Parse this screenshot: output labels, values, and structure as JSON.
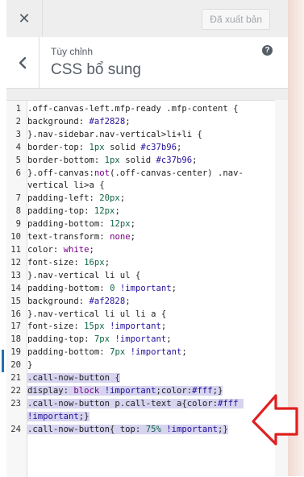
{
  "header": {
    "close_glyph": "✕",
    "publish_label": "Đã xuất bản"
  },
  "section": {
    "breadcrumb": "Tùy chỉnh",
    "title": "CSS bổ sung",
    "help_glyph": "?"
  },
  "editor": {
    "lines": [
      {
        "n": "1",
        "tokens": [
          [
            ".off-canvas-left.mfp-ready .mfp-content {",
            "plain"
          ]
        ]
      },
      {
        "n": "2",
        "tokens": [
          [
            "background: ",
            "plain"
          ],
          [
            "#af2828",
            "str"
          ],
          [
            ";",
            "plain"
          ]
        ]
      },
      {
        "n": "3",
        "tokens": [
          [
            "}.nav-sidebar.nav-vertical>li+li {",
            "plain"
          ]
        ]
      },
      {
        "n": "4",
        "tokens": [
          [
            "border-top: ",
            "plain"
          ],
          [
            "1px",
            "num"
          ],
          [
            " solid ",
            "plain"
          ],
          [
            "#c37b96",
            "str"
          ],
          [
            ";",
            "plain"
          ]
        ]
      },
      {
        "n": "5",
        "tokens": [
          [
            "border-bottom: ",
            "plain"
          ],
          [
            "1px",
            "num"
          ],
          [
            " solid ",
            "plain"
          ],
          [
            "#c37b96",
            "str"
          ],
          [
            ";",
            "plain"
          ]
        ]
      },
      {
        "n": "6",
        "tokens": [
          [
            "}.off-canvas:",
            "plain"
          ],
          [
            "not",
            "kw"
          ],
          [
            "(.off-canvas-center) .nav-vertical li>a {",
            "plain"
          ]
        ]
      },
      {
        "n": "7",
        "tokens": [
          [
            "padding-left: ",
            "plain"
          ],
          [
            "20px",
            "num"
          ],
          [
            ";",
            "plain"
          ]
        ]
      },
      {
        "n": "8",
        "tokens": [
          [
            "padding-top: ",
            "plain"
          ],
          [
            "12px",
            "num"
          ],
          [
            ";",
            "plain"
          ]
        ]
      },
      {
        "n": "9",
        "tokens": [
          [
            "padding-bottom: ",
            "plain"
          ],
          [
            "12px",
            "num"
          ],
          [
            ";",
            "plain"
          ]
        ]
      },
      {
        "n": "10",
        "tokens": [
          [
            "text-transform: ",
            "plain"
          ],
          [
            "none",
            "kw"
          ],
          [
            ";",
            "plain"
          ]
        ]
      },
      {
        "n": "11",
        "tokens": [
          [
            "color: ",
            "plain"
          ],
          [
            "white",
            "kw"
          ],
          [
            ";",
            "plain"
          ]
        ]
      },
      {
        "n": "12",
        "tokens": [
          [
            "font-size: ",
            "plain"
          ],
          [
            "16px",
            "num"
          ],
          [
            ";",
            "plain"
          ]
        ]
      },
      {
        "n": "13",
        "tokens": [
          [
            "}.nav-vertical li ul {",
            "plain"
          ]
        ]
      },
      {
        "n": "14",
        "tokens": [
          [
            "padding-bottom: ",
            "plain"
          ],
          [
            "0",
            "num"
          ],
          [
            " ",
            "plain"
          ],
          [
            "!important",
            "imp"
          ],
          [
            ";",
            "plain"
          ]
        ]
      },
      {
        "n": "15",
        "tokens": [
          [
            "background: ",
            "plain"
          ],
          [
            "#af2828",
            "str"
          ],
          [
            ";",
            "plain"
          ]
        ]
      },
      {
        "n": "16",
        "tokens": [
          [
            "}.nav-vertical li ul li a {",
            "plain"
          ]
        ]
      },
      {
        "n": "17",
        "tokens": [
          [
            "font-size: ",
            "plain"
          ],
          [
            "15px",
            "num"
          ],
          [
            " ",
            "plain"
          ],
          [
            "!important",
            "imp"
          ],
          [
            ";",
            "plain"
          ]
        ]
      },
      {
        "n": "18",
        "tokens": [
          [
            "padding-top: ",
            "plain"
          ],
          [
            "7px",
            "num"
          ],
          [
            " ",
            "plain"
          ],
          [
            "!important",
            "imp"
          ],
          [
            ";",
            "plain"
          ]
        ]
      },
      {
        "n": "19",
        "tokens": [
          [
            "padding-bottom: ",
            "plain"
          ],
          [
            "7px",
            "num"
          ],
          [
            " ",
            "plain"
          ],
          [
            "!important",
            "imp"
          ],
          [
            ";",
            "plain"
          ]
        ]
      },
      {
        "n": "20",
        "tokens": [
          [
            "}",
            "plain"
          ]
        ]
      },
      {
        "n": "21",
        "sel": true,
        "tokens": [
          [
            ".call-now-button {",
            "plain"
          ]
        ]
      },
      {
        "n": "22",
        "sel": true,
        "tokens": [
          [
            "display: ",
            "plain"
          ],
          [
            "block",
            "kw"
          ],
          [
            " ",
            "plain"
          ],
          [
            "!important",
            "imp"
          ],
          [
            ";color:",
            "plain"
          ],
          [
            "#fff",
            "str"
          ],
          [
            ";}",
            "plain"
          ]
        ]
      },
      {
        "n": "23",
        "sel": true,
        "tokens": [
          [
            ".call-now-button p.call-text a{color:",
            "plain"
          ],
          [
            "#fff",
            "str"
          ],
          [
            " ",
            "plain"
          ],
          [
            "!important",
            "imp"
          ],
          [
            ";}",
            "plain"
          ]
        ]
      },
      {
        "n": "24",
        "sel": true,
        "tokens": [
          [
            ".call-now-button{ top: ",
            "plain"
          ],
          [
            "75%",
            "num"
          ],
          [
            " ",
            "plain"
          ],
          [
            "!important",
            "imp"
          ],
          [
            ";}",
            "plain"
          ]
        ]
      }
    ]
  },
  "colors": {
    "arrow": "#e02020",
    "selection": "#d7d4f0",
    "string": "#221199",
    "number": "#116644",
    "keyword": "#770088"
  },
  "icons": {
    "close": "close-icon",
    "back": "chevron-left-icon",
    "help": "help-icon",
    "annotation": "red-arrow-annotation"
  }
}
